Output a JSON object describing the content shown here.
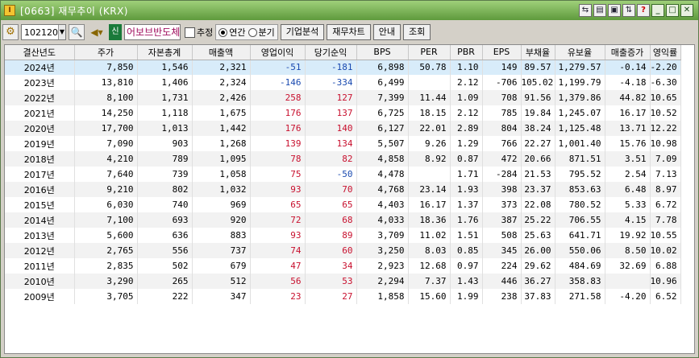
{
  "window": {
    "title": "[0663] 재무추이 (KRX)",
    "app_icon": "I"
  },
  "toolbar": {
    "code": "102120",
    "badge": "신",
    "stock_name": "어보브반도체",
    "check_label": "추정",
    "radio_annual": "연간",
    "radio_quarter": "분기",
    "btn_corp": "기업분석",
    "btn_chart": "재무차트",
    "btn_guide": "안내",
    "btn_search": "조회"
  },
  "colors": {
    "negative": "#1a4ab0",
    "positive": "#c8102e",
    "selected_row": "#d8ecfa"
  },
  "table": {
    "headers": [
      "결산년도",
      "주가",
      "자본총계",
      "매출액",
      "영업이익",
      "당기순익",
      "BPS",
      "PER",
      "PBR",
      "EPS",
      "부채율",
      "유보율",
      "매출증가",
      "영익률"
    ],
    "rows": [
      [
        "2024년",
        "7,850",
        "1,546",
        "2,321",
        "-51",
        "-181",
        "6,898",
        "50.78",
        "1.10",
        "149",
        "89.57",
        "1,279.57",
        "-0.14",
        "-2.20"
      ],
      [
        "2023년",
        "13,810",
        "1,406",
        "2,324",
        "-146",
        "-334",
        "6,499",
        "",
        "2.12",
        "-706",
        "105.02",
        "1,199.79",
        "-4.18",
        "-6.30"
      ],
      [
        "2022년",
        "8,100",
        "1,731",
        "2,426",
        "258",
        "127",
        "7,399",
        "11.44",
        "1.09",
        "708",
        "91.56",
        "1,379.86",
        "44.82",
        "10.65"
      ],
      [
        "2021년",
        "14,250",
        "1,118",
        "1,675",
        "176",
        "137",
        "6,725",
        "18.15",
        "2.12",
        "785",
        "19.84",
        "1,245.07",
        "16.17",
        "10.52"
      ],
      [
        "2020년",
        "17,700",
        "1,013",
        "1,442",
        "176",
        "140",
        "6,127",
        "22.01",
        "2.89",
        "804",
        "38.24",
        "1,125.48",
        "13.71",
        "12.22"
      ],
      [
        "2019년",
        "7,090",
        "903",
        "1,268",
        "139",
        "134",
        "5,507",
        "9.26",
        "1.29",
        "766",
        "22.27",
        "1,001.40",
        "15.76",
        "10.98"
      ],
      [
        "2018년",
        "4,210",
        "789",
        "1,095",
        "78",
        "82",
        "4,858",
        "8.92",
        "0.87",
        "472",
        "20.66",
        "871.51",
        "3.51",
        "7.09"
      ],
      [
        "2017년",
        "7,640",
        "739",
        "1,058",
        "75",
        "-50",
        "4,478",
        "",
        "1.71",
        "-284",
        "21.53",
        "795.52",
        "2.54",
        "7.13"
      ],
      [
        "2016년",
        "9,210",
        "802",
        "1,032",
        "93",
        "70",
        "4,768",
        "23.14",
        "1.93",
        "398",
        "23.37",
        "853.63",
        "6.48",
        "8.97"
      ],
      [
        "2015년",
        "6,030",
        "740",
        "969",
        "65",
        "65",
        "4,403",
        "16.17",
        "1.37",
        "373",
        "22.08",
        "780.52",
        "5.33",
        "6.72"
      ],
      [
        "2014년",
        "7,100",
        "693",
        "920",
        "72",
        "68",
        "4,033",
        "18.36",
        "1.76",
        "387",
        "25.22",
        "706.55",
        "4.15",
        "7.78"
      ],
      [
        "2013년",
        "5,600",
        "636",
        "883",
        "93",
        "89",
        "3,709",
        "11.02",
        "1.51",
        "508",
        "25.63",
        "641.71",
        "19.92",
        "10.55"
      ],
      [
        "2012년",
        "2,765",
        "556",
        "737",
        "74",
        "60",
        "3,250",
        "8.03",
        "0.85",
        "345",
        "26.00",
        "550.06",
        "8.50",
        "10.02"
      ],
      [
        "2011년",
        "2,835",
        "502",
        "679",
        "47",
        "34",
        "2,923",
        "12.68",
        "0.97",
        "224",
        "29.62",
        "484.69",
        "32.69",
        "6.88"
      ],
      [
        "2010년",
        "3,290",
        "265",
        "512",
        "56",
        "53",
        "2,294",
        "7.37",
        "1.43",
        "446",
        "36.27",
        "358.83",
        "",
        "10.96"
      ],
      [
        "2009년",
        "3,705",
        "222",
        "347",
        "23",
        "27",
        "1,858",
        "15.60",
        "1.99",
        "238",
        "37.83",
        "271.58",
        "-4.20",
        "6.52"
      ]
    ]
  }
}
